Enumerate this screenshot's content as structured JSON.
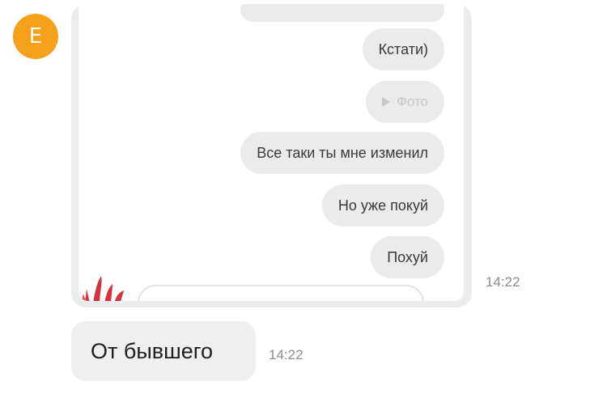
{
  "sender": {
    "avatar_letter": "E",
    "avatar_color": "#f5a11b"
  },
  "screenshot": {
    "bubbles": [
      {
        "text": "Кстати)"
      },
      {
        "text": "Фото",
        "icon": "play-icon"
      },
      {
        "text": "Все таки ты мне изменил"
      },
      {
        "text": "Но уже покуй"
      },
      {
        "text": "Похуй"
      }
    ],
    "time": "14:22"
  },
  "message": {
    "text": "От бывшего",
    "time": "14:22"
  }
}
